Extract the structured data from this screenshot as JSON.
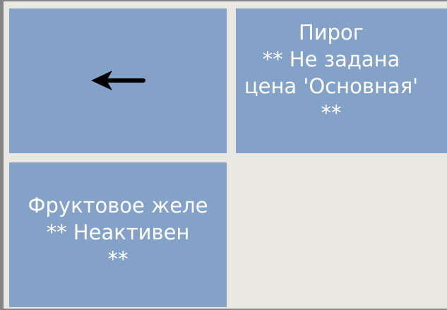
{
  "icons": {
    "back": "arrow-left-icon"
  },
  "colors": {
    "tile_background": "#84a2c8",
    "tile_text": "#ffffff",
    "panel_background": "#e9e8e2"
  },
  "tiles": [
    {
      "kind": "back"
    },
    {
      "kind": "product",
      "name": "Пирог",
      "status_lines": [
        "** Не задана",
        "цена 'Основная'",
        "**"
      ]
    },
    {
      "kind": "product",
      "name": "Фруктовое желе",
      "status_lines": [
        "** Неактивен",
        "**"
      ]
    }
  ]
}
